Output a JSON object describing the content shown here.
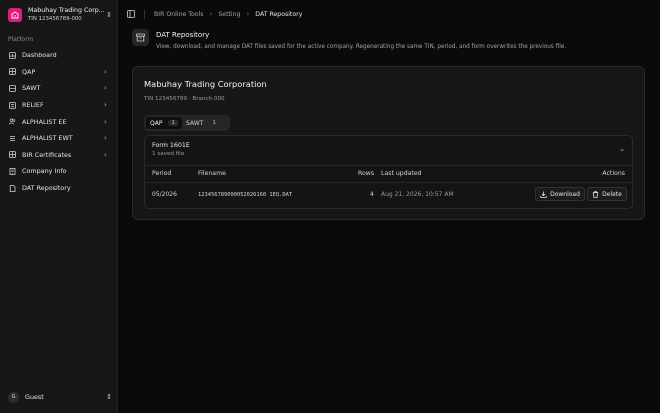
{
  "company": {
    "name": "Mabuhay Trading Corp...",
    "tin": "TIN 123456789-000"
  },
  "sidebar": {
    "group_label": "Platform",
    "items": [
      {
        "label": "Dashboard",
        "icon": "dashboard-icon"
      },
      {
        "label": "QAP",
        "icon": "grid-icon"
      },
      {
        "label": "SAWT",
        "icon": "grid-icon"
      },
      {
        "label": "RELIEF",
        "icon": "list-icon"
      },
      {
        "label": "ALPHALIST EE",
        "icon": "users-icon"
      },
      {
        "label": "ALPHALIST EWT",
        "icon": "list-icon"
      },
      {
        "label": "BIR Certificates",
        "icon": "grid-icon"
      },
      {
        "label": "Company Info",
        "icon": "building-icon"
      },
      {
        "label": "DAT Repository",
        "icon": "file-icon"
      }
    ]
  },
  "user": {
    "initial": "G",
    "name": "Guest"
  },
  "breadcrumb": {
    "root": "BIR Online Tools",
    "section": "Setting",
    "current": "DAT Repository"
  },
  "page": {
    "title": "DAT Repository",
    "description": "View, download, and manage DAT files saved for the active company. Regenerating the same TIN, period, and form overwrites the previous file."
  },
  "card": {
    "company_name": "Mabuhay Trading Corporation",
    "tin_branch": "TIN 123456789 · Branch 000",
    "tabs": [
      {
        "label": "QAP",
        "count": "1"
      },
      {
        "label": "SAWT",
        "count": "1"
      }
    ],
    "form": {
      "name": "Form 1601E",
      "count": "1 saved file",
      "columns": {
        "period": "Period",
        "filename": "Filename",
        "rows": "Rows",
        "updated": "Last updated",
        "actions": "Actions"
      },
      "rows": [
        {
          "period": "05/2026",
          "filename": "123456789000052026160 1EQ.DAT",
          "rows": "4",
          "updated": "Aug 21, 2026, 10:57 AM"
        }
      ],
      "download_label": "Download",
      "delete_label": "Delete"
    }
  },
  "colors": {
    "brand": "#e11d77",
    "background": "#0a0a0a",
    "sidebar": "#171717"
  }
}
